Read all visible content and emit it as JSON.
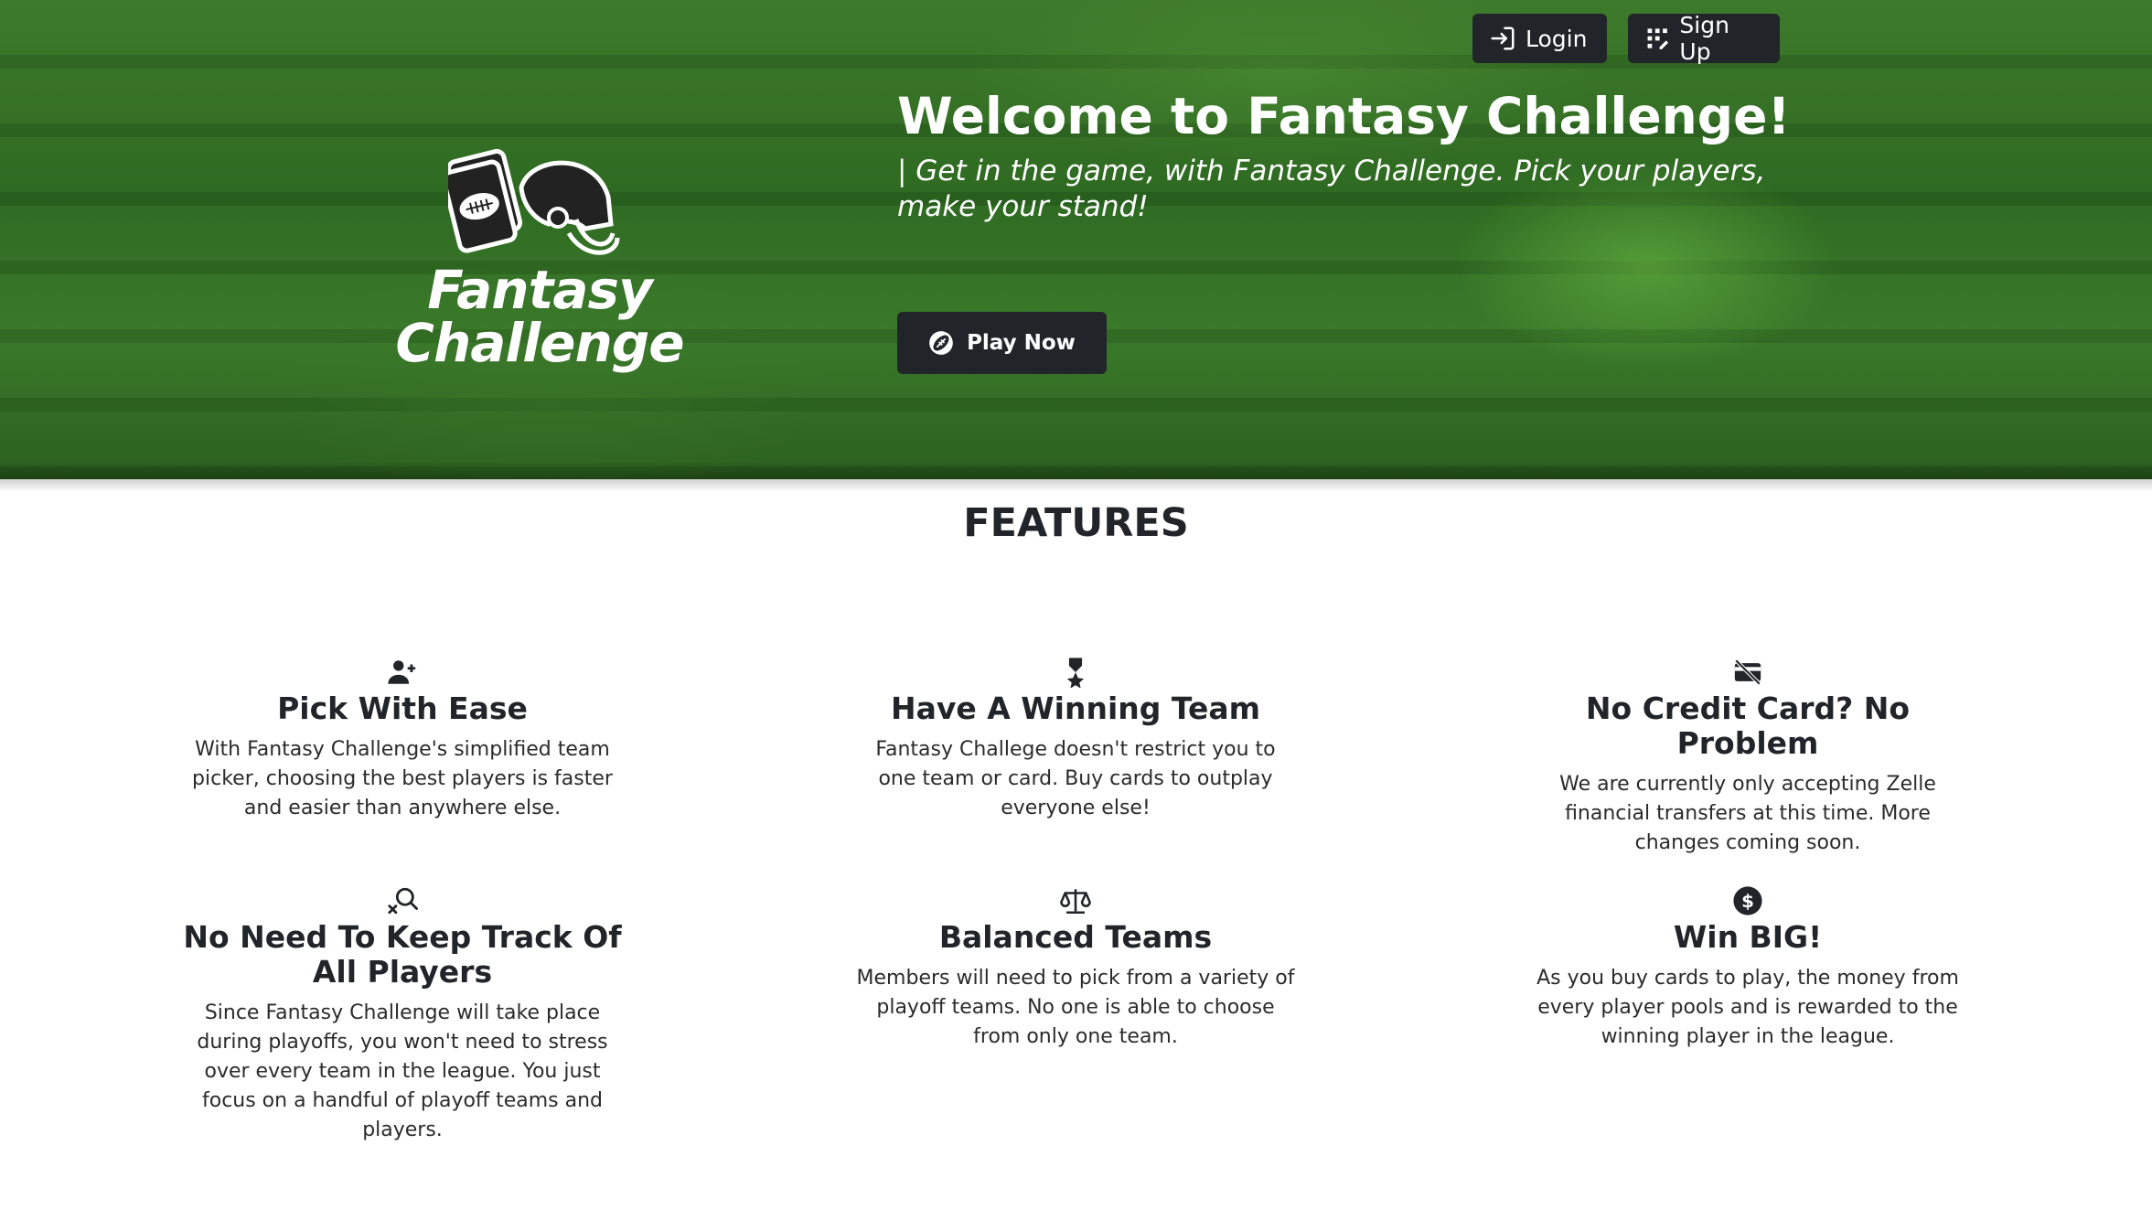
{
  "nav": {
    "login_label": "Login",
    "signup_label": "Sign Up"
  },
  "logo": {
    "line1": "Fantasy",
    "line2": "Challenge"
  },
  "hero": {
    "title": "Welcome to Fantasy Challenge!",
    "subtitle": "| Get in the game, with Fantasy Challenge. Pick your players, make your stand!",
    "cta_label": "Play Now"
  },
  "features": {
    "heading": "FEATURES",
    "items": [
      {
        "icon": "person-plus-icon",
        "title": "Pick With Ease",
        "text": "With Fantasy Challenge's simplified team picker, choosing the best players is faster and easier than anywhere else."
      },
      {
        "icon": "award-icon",
        "title": "Have A Winning Team",
        "text": "Fantasy Challege doesn't restrict you to one team or card. Buy cards to outplay everyone else!"
      },
      {
        "icon": "credit-card-off-icon",
        "title": "No Credit Card? No Problem",
        "text": "We are currently only accepting Zelle financial transfers at this time. More changes coming soon."
      },
      {
        "icon": "search-x-icon",
        "title": "No Need To Keep Track Of All Players",
        "text": "Since Fantasy Challenge will take place during playoffs, you won't need to stress over every team in the league. You just focus on a handful of playoff teams and players."
      },
      {
        "icon": "scales-icon",
        "title": "Balanced Teams",
        "text": "Members will need to pick from a variety of playoff teams. No one is able to choose from only one team."
      },
      {
        "icon": "dollar-coin-icon",
        "title": "Win BIG!",
        "text": "As you buy cards to play, the money from every player pools and is rewarded to the winning player in the league."
      }
    ]
  },
  "colors": {
    "button_bg": "#212529",
    "hero_green": "#3a7a2a",
    "text": "#212529"
  }
}
